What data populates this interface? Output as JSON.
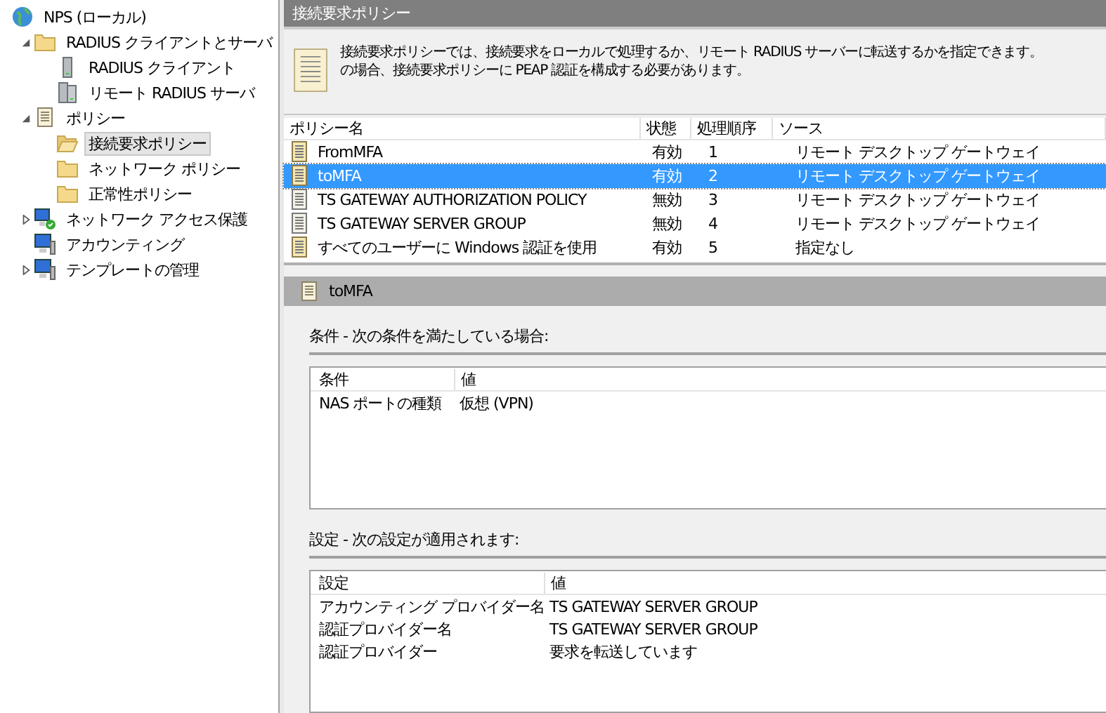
{
  "tree": [
    {
      "label": "NPS (ローカル)",
      "kind": "globe",
      "selected": false,
      "children": [
        {
          "label": "RADIUS クライアントとサーバ",
          "kind": "folder",
          "expanded": true,
          "selected": false,
          "children": [
            {
              "label": "RADIUS クライアント",
              "kind": "server",
              "selected": false
            },
            {
              "label": "リモート RADIUS サーバ",
              "kind": "servers",
              "selected": false
            }
          ]
        },
        {
          "label": "ポリシー",
          "kind": "policy",
          "expanded": true,
          "selected": false,
          "children": [
            {
              "label": "接続要求ポリシー",
              "kind": "folder-open",
              "selected": true
            },
            {
              "label": "ネットワーク ポリシー",
              "kind": "folder",
              "selected": false
            },
            {
              "label": "正常性ポリシー",
              "kind": "folder",
              "selected": false
            }
          ]
        },
        {
          "label": "ネットワーク アクセス保護",
          "kind": "nap",
          "expanded": false,
          "selected": false
        },
        {
          "label": "アカウンティング",
          "kind": "computer",
          "selected": false
        },
        {
          "label": "テンプレートの管理",
          "kind": "computer",
          "expanded": false,
          "selected": false
        }
      ]
    }
  ],
  "main": {
    "title": "接続要求ポリシー",
    "description": [
      "接続要求ポリシーでは、接続要求をローカルで処理するか、リモート RADIUS サーバーに転送するかを指定できます。",
      "の場合、接続要求ポリシーに PEAP 認証を構成する必要があります。"
    ],
    "table": {
      "columns": [
        "ポリシー名",
        "状態",
        "処理順序",
        "ソース"
      ],
      "rows": [
        {
          "cells": [
            "FromMFA",
            "有効",
            "1",
            "リモート デスクトップ ゲートウェイ"
          ],
          "enabled": true,
          "selected": false
        },
        {
          "cells": [
            "toMFA",
            "有効",
            "2",
            "リモート デスクトップ ゲートウェイ"
          ],
          "enabled": true,
          "selected": true
        },
        {
          "cells": [
            "TS GATEWAY AUTHORIZATION POLICY",
            "無効",
            "3",
            "リモート デスクトップ ゲートウェイ"
          ],
          "enabled": false,
          "selected": false
        },
        {
          "cells": [
            "TS GATEWAY SERVER GROUP",
            "無効",
            "4",
            "リモート デスクトップ ゲートウェイ"
          ],
          "enabled": false,
          "selected": false
        },
        {
          "cells": [
            "すべてのユーザーに Windows 認証を使用",
            "有効",
            "5",
            "指定なし"
          ],
          "enabled": true,
          "selected": false
        }
      ]
    }
  },
  "detail": {
    "title": "toMFA",
    "sections": [
      {
        "heading": "条件 - 次の条件を満たしている場合:",
        "columns": [
          "条件",
          "値"
        ],
        "rows": [
          [
            "NAS ポートの種類",
            "仮想 (VPN)"
          ]
        ]
      },
      {
        "heading": "設定 - 次の設定が適用されます:",
        "columns": [
          "設定",
          "値"
        ],
        "rows": [
          [
            "アカウンティング プロバイダー名",
            "TS GATEWAY SERVER GROUP"
          ],
          [
            "認証プロバイダー名",
            "TS GATEWAY SERVER GROUP"
          ],
          [
            "認証プロバイダー",
            "要求を転送しています"
          ]
        ]
      }
    ]
  }
}
